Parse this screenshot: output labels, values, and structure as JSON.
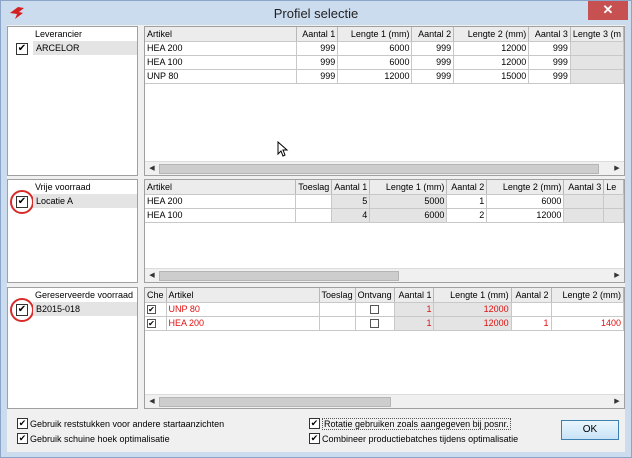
{
  "window": {
    "title": "Profiel selectie",
    "close_glyph": "✕",
    "app_icon": "app-logo-icon"
  },
  "colors": {
    "titlebar": "#ccdcef",
    "close_button": "#c75050",
    "red_text": "#e01010",
    "highlight_circle": "#d92a2a"
  },
  "supplier_panel": {
    "header": "Leverancier",
    "items": [
      {
        "label": "ARCELOR",
        "checked": true
      }
    ],
    "grid": {
      "columns": [
        "Artikel",
        "Aantal 1",
        "Lengte 1 (mm)",
        "Aantal 2",
        "Lengte 2 (mm)",
        "Aantal 3",
        "Lengte 3 (m"
      ],
      "rows": [
        [
          "HEA  200",
          "999",
          "6000",
          "999",
          "12000",
          "999",
          ""
        ],
        [
          "HEA  100",
          "999",
          "6000",
          "999",
          "12000",
          "999",
          ""
        ],
        [
          "UNP  80",
          "999",
          "12000",
          "999",
          "15000",
          "999",
          ""
        ]
      ]
    }
  },
  "free_stock_panel": {
    "header": "Vrije voorraad",
    "items": [
      {
        "label": "Locatie A",
        "checked": true
      }
    ],
    "grid": {
      "columns": [
        "Artikel",
        "Toeslag",
        "Aantal 1",
        "Lengte 1 (mm)",
        "Aantal 2",
        "Lengte 2 (mm)",
        "Aantal 3",
        "Le"
      ],
      "rows": [
        [
          "HEA  200",
          "",
          "5",
          "5000",
          "1",
          "6000",
          "",
          ""
        ],
        [
          "HEA  100",
          "",
          "4",
          "6000",
          "2",
          "12000",
          "",
          ""
        ]
      ]
    }
  },
  "reserved_stock_panel": {
    "header": "Gereserveerde voorraad",
    "items": [
      {
        "label": "B2015-018",
        "checked": true
      }
    ],
    "grid": {
      "columns": [
        "Che",
        "Artikel",
        "Toeslag",
        "Ontvang",
        "Aantal 1",
        "Lengte 1 (mm)",
        "Aantal 2",
        "Lengte 2 (mm)"
      ],
      "rows": [
        [
          "✔",
          "UNP  80",
          "",
          "",
          "1",
          "12000",
          "",
          ""
        ],
        [
          "✔",
          "HEA  200",
          "",
          "",
          "1",
          "12000",
          "1",
          "1400"
        ]
      ]
    }
  },
  "options": {
    "use_remnants": {
      "label": "Gebruik reststukken voor andere startaanzichten",
      "checked": true
    },
    "use_bevel": {
      "label": "Gebruik schuine hoek optimalisatie",
      "checked": true
    },
    "rotation": {
      "label": "Rotatie gebruiken zoals aangegeven bij posnr.",
      "checked": true
    },
    "combine_batches": {
      "label": "Combineer productiebatches tijdens optimalisatie",
      "checked": true
    }
  },
  "ok_button": {
    "label": "OK"
  },
  "check_glyph": "✔",
  "scroll": {
    "left_arrow": "◀",
    "right_arrow": "▶"
  }
}
